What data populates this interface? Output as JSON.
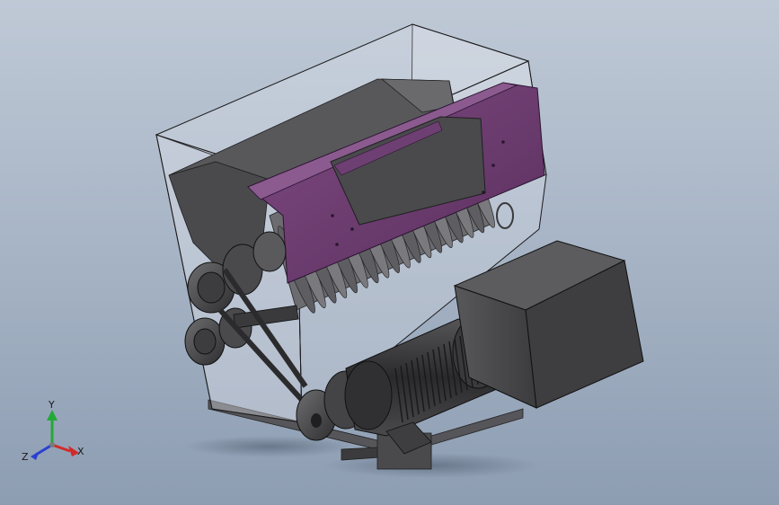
{
  "viewport": {
    "background_top": "#bfc9d6",
    "background_bottom": "#8d9db2"
  },
  "model": {
    "parts": [
      "glass-housing",
      "purple-cover-plate",
      "cutting-drum",
      "belt-pulleys",
      "drive-belts",
      "electric-motor",
      "gearbox-block",
      "base-frame"
    ],
    "colors": {
      "housing_glass": "#d8dde6",
      "cover_plate": "#6b3c6e",
      "metal_dark": "#3c3c3e",
      "metal_mid": "#5a5a5c",
      "metal_light": "#8a8a8c",
      "gearbox": "#4a4a4c"
    }
  },
  "triad": {
    "x_label": "X",
    "y_label": "Y",
    "z_label": "Z",
    "x_color": "#d22a2a",
    "y_color": "#25a83a",
    "z_color": "#2a3fd2"
  }
}
